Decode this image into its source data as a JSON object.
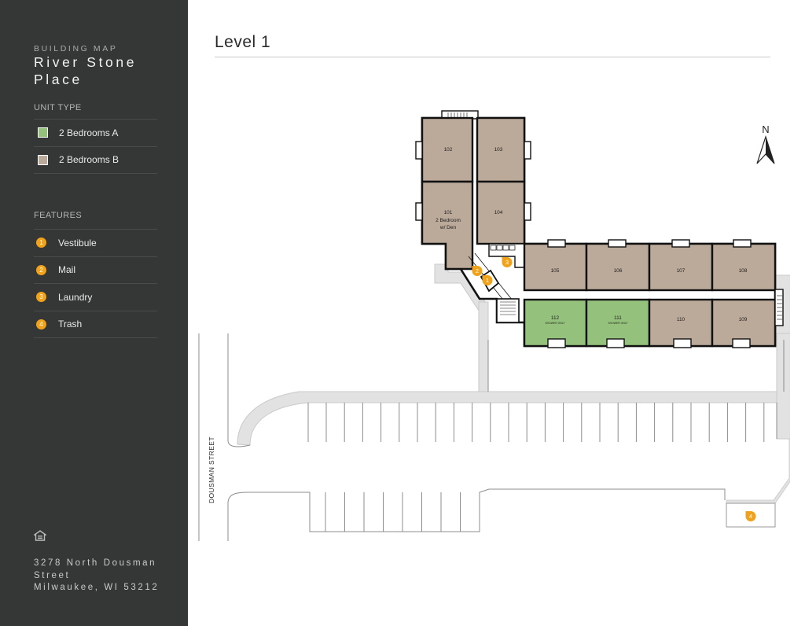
{
  "sidebar": {
    "kicker": "BUILDING MAP",
    "name_line1": "River Stone",
    "name_line2": "Place",
    "unit_type_title": "UNIT TYPE",
    "unit_types": [
      {
        "label": "2 Bedrooms A",
        "color": "#94c27c"
      },
      {
        "label": "2 Bedrooms B",
        "color": "#bba999"
      }
    ],
    "features_title": "FEATURES",
    "features": [
      {
        "num": "1",
        "label": "Vestibule"
      },
      {
        "num": "2",
        "label": "Mail"
      },
      {
        "num": "3",
        "label": "Laundry"
      },
      {
        "num": "4",
        "label": "Trash"
      }
    ],
    "equal_housing_icon": "equal-housing-icon",
    "address_line1": "3278 North Dousman",
    "address_line2": "Street",
    "address_line3": "Milwaukee, WI 53212"
  },
  "main": {
    "level_title": "Level 1"
  },
  "map": {
    "street_label": "DOUSMAN STREET",
    "north_label": "N",
    "colors": {
      "unit_a": "#94c27c",
      "unit_b": "#bba999",
      "feature": "#f0a21a",
      "pavement": "#e2e2e2",
      "wall": "#111111"
    },
    "units": {
      "u102": "102",
      "u103": "103",
      "u101": "101",
      "u101_sub1": "2 Bedroom",
      "u101_sub2": "w/ Den",
      "u104": "104",
      "u105": "105",
      "u106": "106",
      "u107": "107",
      "u108": "108",
      "u112": "112",
      "u112_note": "SHOWER ONLY",
      "u111": "111",
      "u111_note": "SHOWER ONLY",
      "u110": "110",
      "u109": "109"
    },
    "markers": {
      "laundry": "3",
      "mail": "2",
      "vestibule": "1",
      "trash": "4"
    }
  }
}
